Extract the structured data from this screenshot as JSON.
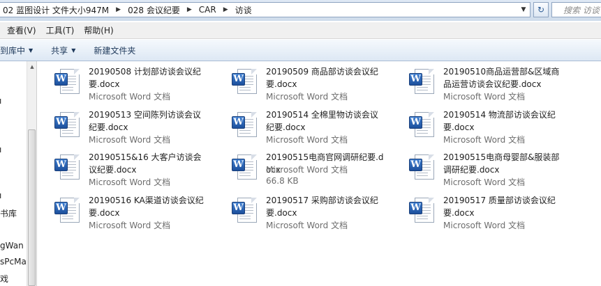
{
  "address": {
    "crumbs": [
      "02 蓝图设计 文件大小947M",
      "028 会议纪要",
      "CAR",
      "访谈"
    ]
  },
  "search": {
    "placeholder": "搜索 访谈"
  },
  "menu": {
    "items": [
      "查看(V)",
      "工具(T)",
      "帮助(H)"
    ]
  },
  "toolbar": {
    "include_label": "到库中",
    "share_label": "共享",
    "new_folder_label": "新建文件夹"
  },
  "nav": {
    "items": [
      "书库",
      "gWan",
      "sPcMa",
      "戏"
    ]
  },
  "files": [
    {
      "name": "20190508 计划部访谈会议纪要.docx",
      "type": "Microsoft Word 文档"
    },
    {
      "name": "20190509 商品部访谈会议纪要.docx",
      "type": "Microsoft Word 文档"
    },
    {
      "name": "20190510商品运营部&区域商品运营访谈会议纪要.docx",
      "type": "Microsoft Word 文档"
    },
    {
      "name": "20190513 空间陈列访谈会议纪要.docx",
      "type": "Microsoft Word 文档"
    },
    {
      "name": "20190514 全棉里物访谈会议纪要.docx",
      "type": "Microsoft Word 文档"
    },
    {
      "name": "20190514 物流部访谈会议纪要.docx",
      "type": "Microsoft Word 文档"
    },
    {
      "name": "20190515&16 大客户访谈会议纪要.docx",
      "type": "Microsoft Word 文档"
    },
    {
      "name": "20190515电商官网调研纪要.docx",
      "type": "Microsoft Word 文档",
      "size": "66.8 KB"
    },
    {
      "name": "20190515电商母婴部&服装部调研纪要.docx",
      "type": "Microsoft Word 文档"
    },
    {
      "name": "20190516 KA渠道访谈会议纪要.docx",
      "type": "Microsoft Word 文档"
    },
    {
      "name": "20190517 采购部访谈会议纪要.docx",
      "type": "Microsoft Word 文档"
    },
    {
      "name": "20190517 质量部访谈会议纪要.docx",
      "type": "Microsoft Word 文档"
    }
  ],
  "icons": {
    "word": "W",
    "file_icon": "word-document-icon"
  },
  "colors": {
    "toolbar_text": "#1e395b",
    "word_blue": "#2b5fae"
  }
}
